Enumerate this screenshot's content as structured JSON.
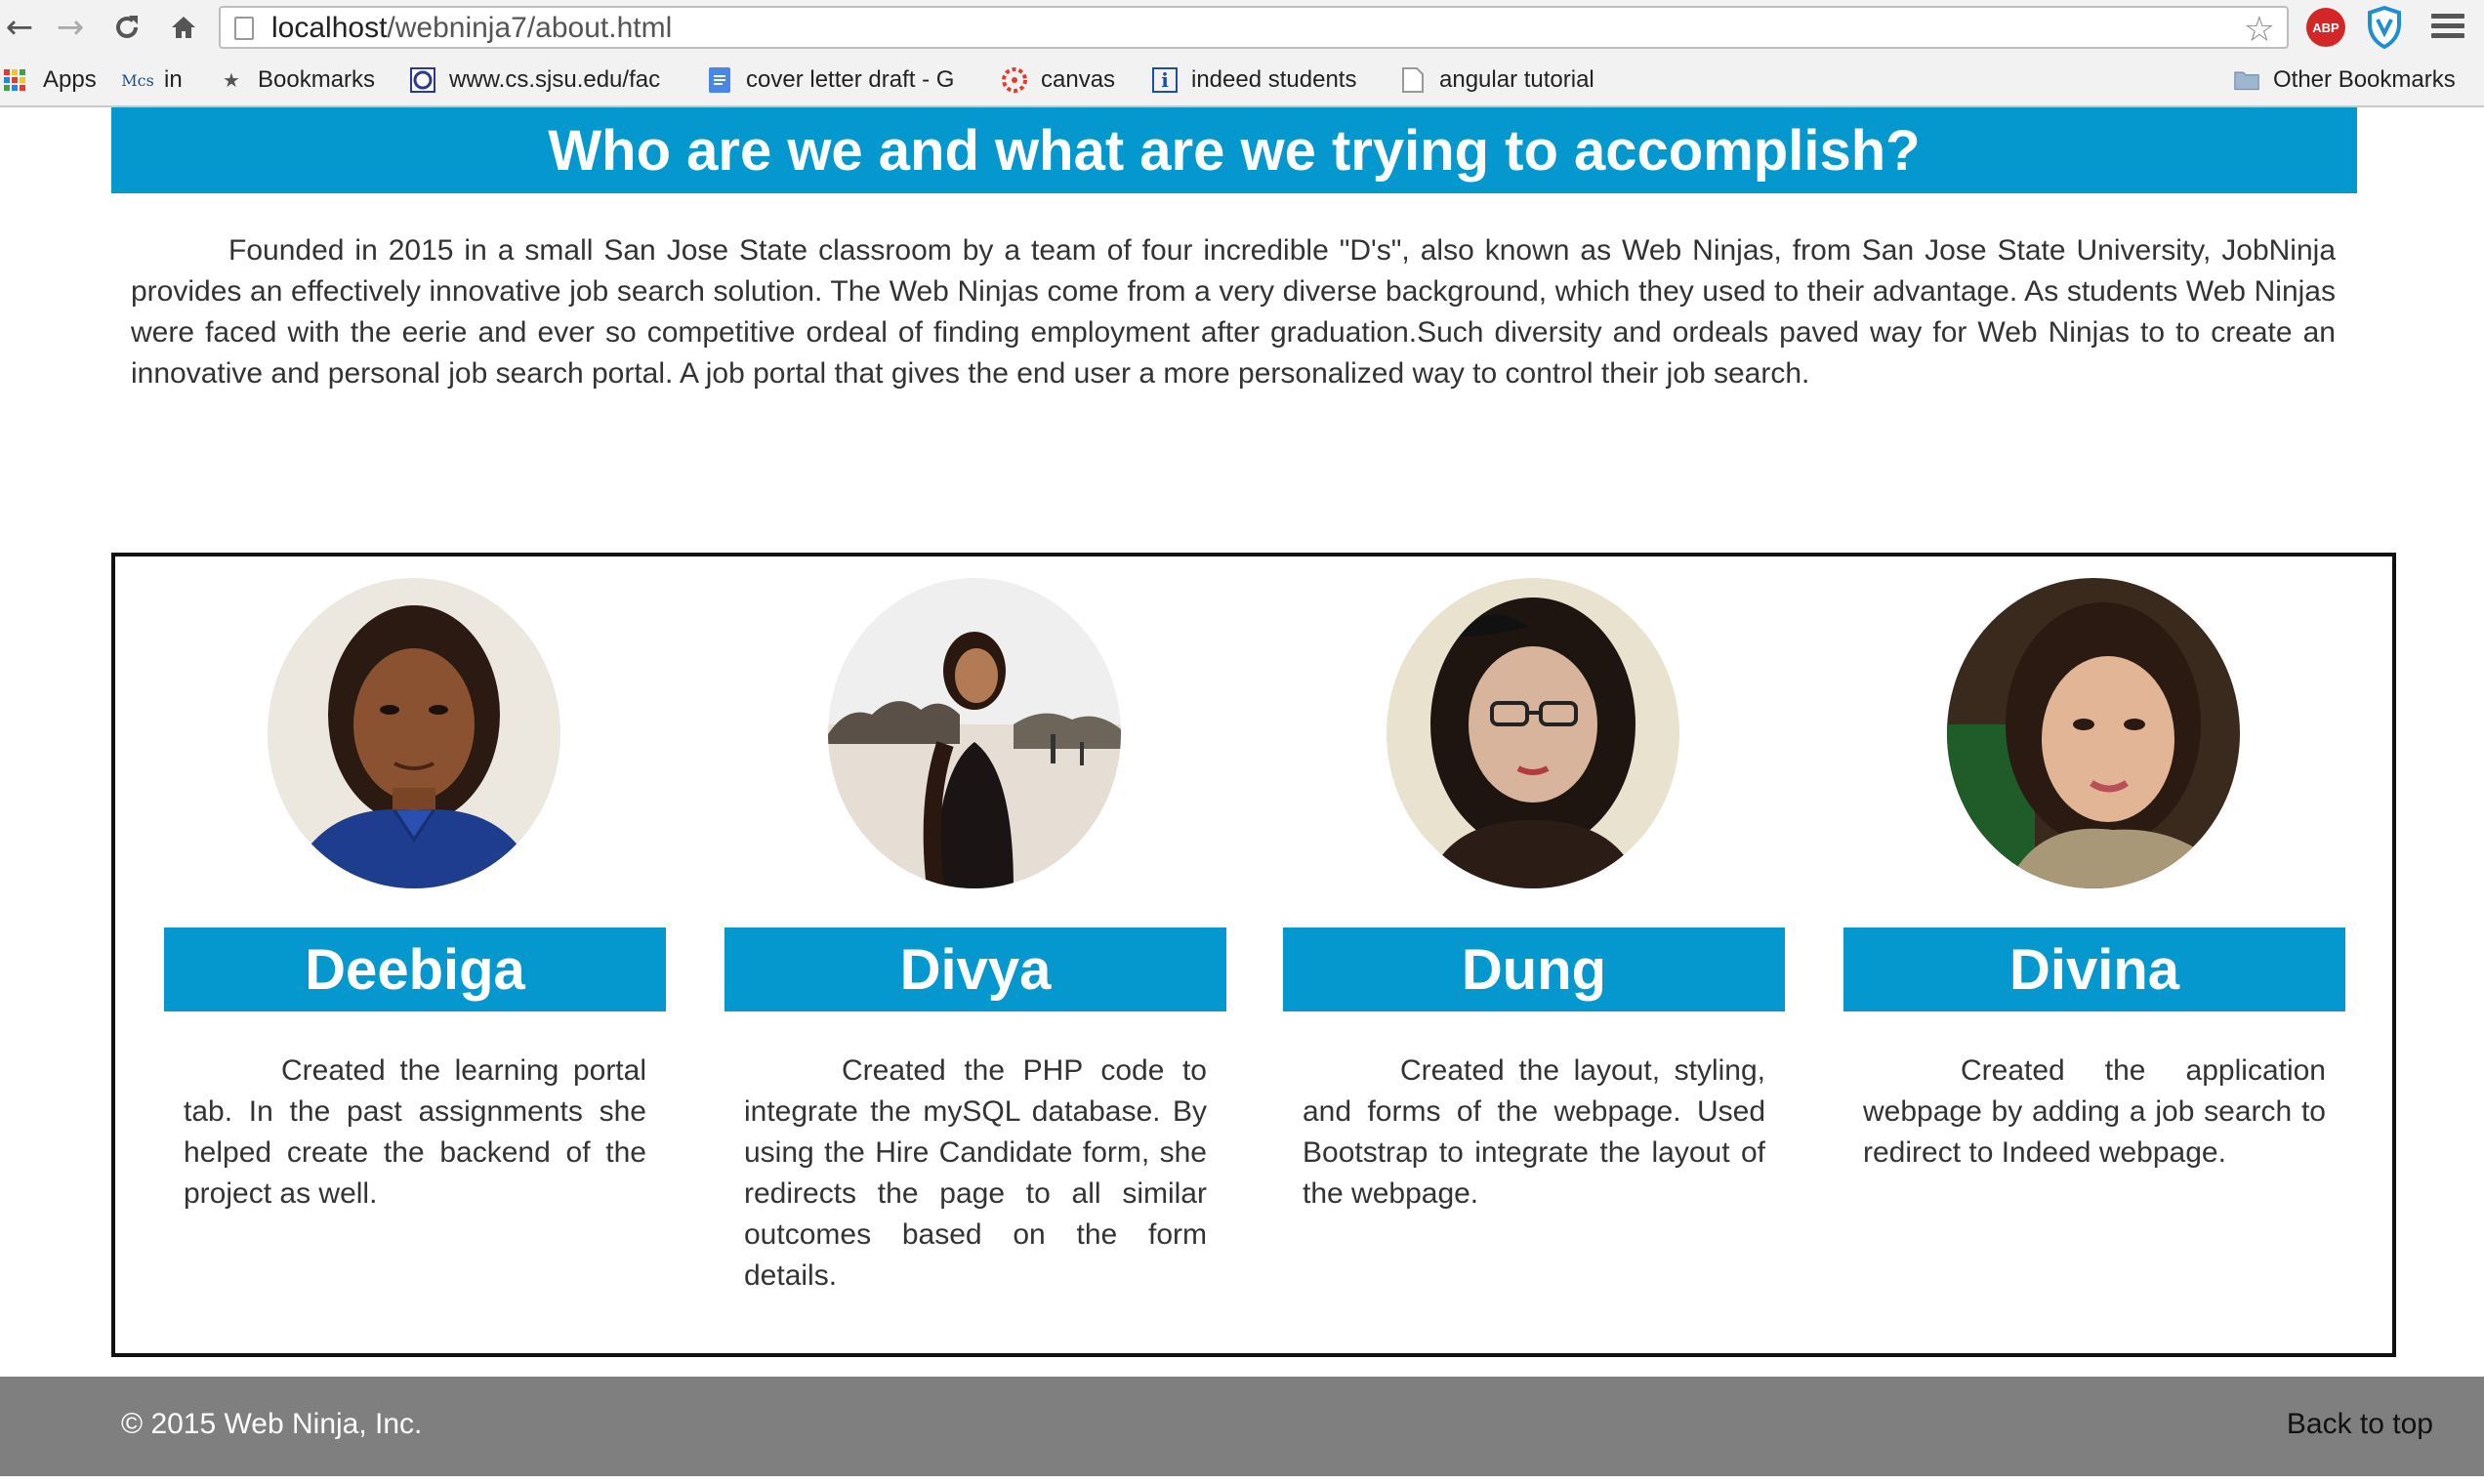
{
  "browser": {
    "url_host": "localhost",
    "url_path": "/webninja7/about.html",
    "abp_label": "ABP",
    "bookmarks": [
      {
        "label": "Apps",
        "icon": "apps-grid-icon"
      },
      {
        "label": "in",
        "icon": "mcs-icon",
        "icon_text": "Mcs"
      },
      {
        "label": "Bookmarks",
        "icon": "star-icon"
      },
      {
        "label": "www.cs.sjsu.edu/fac",
        "icon": "sjsu-icon"
      },
      {
        "label": "cover letter draft - G",
        "icon": "docs-icon"
      },
      {
        "label": "canvas",
        "icon": "canvas-icon"
      },
      {
        "label": "indeed students",
        "icon": "indeed-icon",
        "icon_text": "i"
      },
      {
        "label": "angular tutorial",
        "icon": "page-icon"
      }
    ],
    "other_bookmarks": "Other Bookmarks"
  },
  "header": {
    "title": "Who are we and what are we trying to accomplish?"
  },
  "intro": {
    "text": "Founded in 2015 in a small San Jose State classroom by a team of four incredible \"D's\", also known as Web Ninjas, from San Jose State University, JobNinja provides an effectively innovative job search solution. The Web Ninjas come from a very diverse background, which they used to their advantage. As students Web Ninjas were faced with the eerie and ever so competitive ordeal of finding employment after graduation.Such diversity and ordeals paved way for Web Ninjas to to create an innovative and personal job search portal. A job portal that gives the end user a more personalized way to control their job search."
  },
  "team": [
    {
      "name": "Deebiga",
      "description": "Created the learning portal tab. In the past assignments she helped create the backend of the project as well."
    },
    {
      "name": "Divya",
      "description": "Created the PHP code to integrate the mySQL database. By using the Hire Candidate form, she redirects the page to all similar outcomes based on the form details."
    },
    {
      "name": "Dung",
      "description": "Created the layout, styling, and forms of the webpage. Used Bootstrap to integrate the layout of the webpage."
    },
    {
      "name": "Divina",
      "description": "Created the application webpage by adding a job search to redirect to Indeed webpage."
    }
  ],
  "footer": {
    "copyright": "© 2015 Web Ninja, Inc.",
    "back_to_top": "Back to top"
  },
  "colors": {
    "accent": "#0598cf",
    "footer": "#7f7f7f"
  }
}
